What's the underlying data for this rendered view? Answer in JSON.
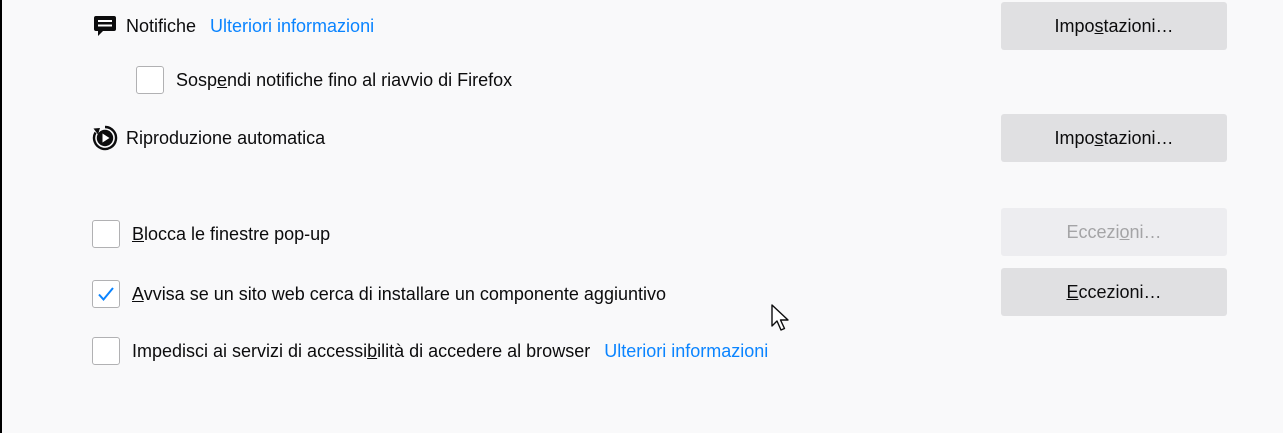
{
  "notifications": {
    "icon": "message-bubble-icon",
    "label": "Notifiche",
    "link": "Ulteriori informazioni",
    "button": {
      "pre": "Impo",
      "key": "s",
      "post": "tazioni…"
    }
  },
  "suspend_notifications": {
    "checked": false,
    "pre": "Sosp",
    "key": "e",
    "post": "ndi notifiche fino al riavvio di Firefox"
  },
  "autoplay": {
    "icon": "autoplay-icon",
    "label": "Riproduzione automatica",
    "button": {
      "pre": "Impo",
      "key": "s",
      "post": "tazioni…"
    }
  },
  "block_popups": {
    "checked": false,
    "pre": "",
    "key": "B",
    "post": "locca le finestre pop-up",
    "button": {
      "pre": "Eccezi",
      "key": "o",
      "post": "ni…",
      "disabled": true
    }
  },
  "warn_addons": {
    "checked": true,
    "pre": "",
    "key": "A",
    "post": "vvisa se un sito web cerca di installare un componente aggiuntivo",
    "button": {
      "pre": "",
      "key": "E",
      "post": "ccezioni…",
      "disabled": false
    }
  },
  "accessibility": {
    "checked": false,
    "pre": "Impedisci ai servizi di accessi",
    "key": "b",
    "post": "ilità di accedere al browser",
    "link": "Ulteriori informazioni"
  },
  "colors": {
    "accent": "#0a84ff",
    "button": "#e0e0e2",
    "button_disabled": "#ededf0"
  }
}
